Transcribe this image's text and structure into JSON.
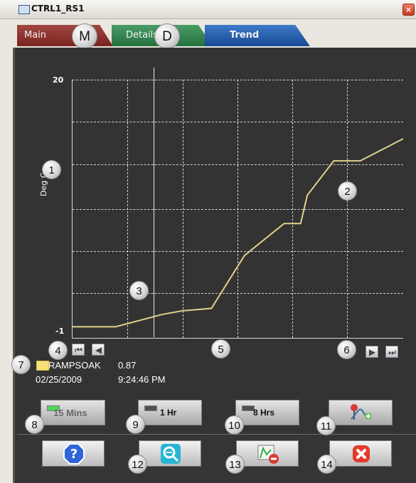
{
  "window": {
    "title": "CTRL1_RS1",
    "close_label": "×"
  },
  "tabs": [
    {
      "label": "Main"
    },
    {
      "label": "Details"
    },
    {
      "label": "Trend"
    }
  ],
  "tab_markers": [
    "M",
    "D"
  ],
  "chart_data": {
    "type": "line",
    "x": [
      0.0,
      0.13,
      0.27,
      0.33,
      0.42,
      0.52,
      0.64,
      0.69,
      0.71,
      0.79,
      0.87,
      1.0
    ],
    "values": [
      -0.1,
      -0.1,
      0.9,
      1.2,
      1.4,
      5.7,
      8.3,
      8.3,
      10.6,
      13.4,
      13.4,
      15.2
    ],
    "ylabel": "Deg C",
    "y_ticks": [
      "20",
      "-1"
    ],
    "ylim": [
      -1,
      20
    ],
    "grid": true,
    "line_color": "#dfd08a"
  },
  "callouts": [
    "1",
    "2",
    "3",
    "4",
    "5",
    "6",
    "7",
    "8",
    "9",
    "10",
    "11",
    "12",
    "13",
    "14"
  ],
  "nav": {
    "left_first": "⏮",
    "left_prev": "◀",
    "right_next": "▶",
    "right_last": "⏭"
  },
  "legend": {
    "tag": "RAMPSOAK",
    "value": "0.87",
    "date": "02/25/2009",
    "time": "9:24:46 PM"
  },
  "buttons": {
    "btn15": "15 Mins",
    "btn1": "1 Hr",
    "btn8": "8 Hrs"
  },
  "icons": {
    "trend-add": "trend-add-icon",
    "help": "help-icon",
    "zoom": "zoom-icon",
    "trend-remove": "trend-remove-icon",
    "close": "close-icon"
  }
}
